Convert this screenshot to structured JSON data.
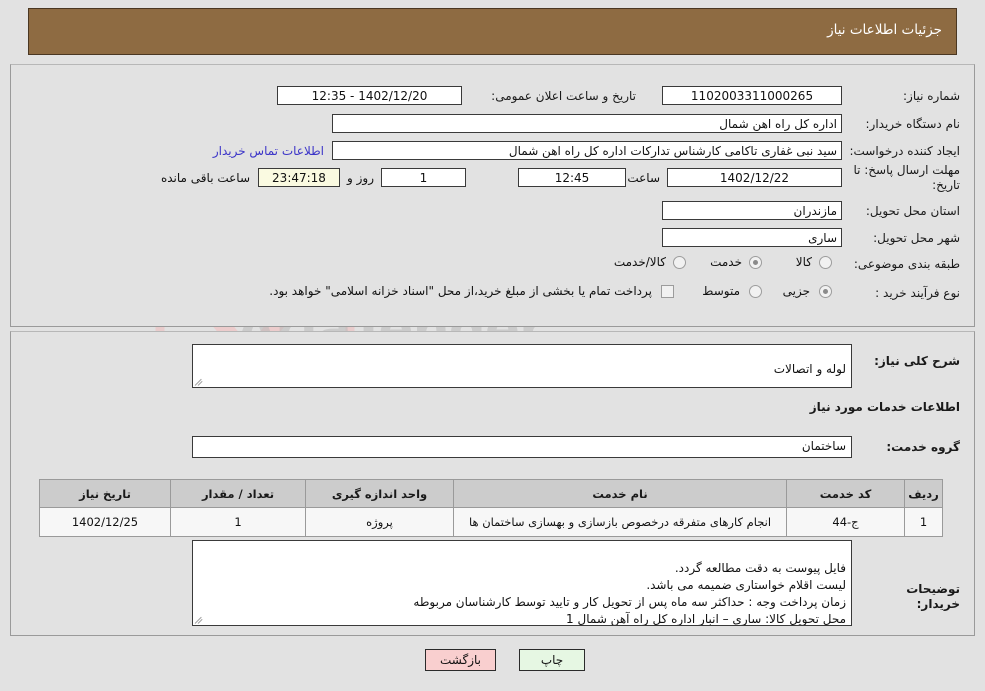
{
  "header": {
    "title": "جزئیات اطلاعات نیاز"
  },
  "top_form": {
    "need_number_label": "شماره نیاز:",
    "need_number_value": "1102003311000265",
    "announce_datetime_label": "تاریخ و ساعت اعلان عمومی:",
    "announce_datetime_value": "1402/12/20 - 12:35",
    "buyer_org_label": "نام دستگاه خریدار:",
    "buyer_org_value": "اداره کل راه اهن شمال",
    "requester_label": "ایجاد کننده درخواست:",
    "requester_value": "سید نبی غفاری تاکامی کارشناس تدارکات اداره کل راه اهن شمال",
    "contact_link": "اطلاعات تماس خریدار",
    "deadline_label": "مهلت ارسال پاسخ: تا تاریخ:",
    "deadline_date": "1402/12/22",
    "hour_label": "ساعت",
    "deadline_time": "12:45",
    "days_remaining": "1",
    "day_and_label": "روز و",
    "countdown": "23:47:18",
    "remaining_label": "ساعت باقی مانده",
    "province_label": "استان محل تحویل:",
    "province_value": "مازندران",
    "city_label": "شهر محل تحویل:",
    "city_value": "ساری",
    "category_label": "طبقه بندی موضوعی:",
    "category_options": [
      {
        "label": "کالا",
        "selected": false
      },
      {
        "label": "خدمت",
        "selected": true
      },
      {
        "label": "کالا/خدمت",
        "selected": false
      }
    ],
    "purchase_type_label": "نوع فرآیند خرید :",
    "purchase_type_options": [
      {
        "label": "جزیی",
        "selected": true
      },
      {
        "label": "متوسط",
        "selected": false
      }
    ],
    "treasury_checkbox_checked": false,
    "treasury_text": "پرداخت تمام یا بخشی از مبلغ خرید،از محل \"اسناد خزانه اسلامی\" خواهد بود."
  },
  "middle": {
    "general_desc_label": "شرح کلی نیاز:",
    "general_desc_value": "لوله و اتصالات",
    "services_heading": "اطلاعات خدمات مورد نیاز",
    "service_group_label": "گروه خدمت:",
    "service_group_value": "ساختمان",
    "table": {
      "headers": [
        "ردیف",
        "کد خدمت",
        "نام خدمت",
        "واحد اندازه گیری",
        "تعداد / مقدار",
        "تاریخ نیاز"
      ],
      "rows": [
        {
          "row": "1",
          "code": "ج-44",
          "name": "انجام کارهای متفرقه درخصوص بازسازی و بهسازی ساختمان ها",
          "unit": "پروژه",
          "qty": "1",
          "need_date": "1402/12/25"
        }
      ]
    },
    "buyer_notes_label": "توضیحات خریدار:",
    "buyer_notes_value": "فایل پیوست به دقت مطالعه گردد.\nلیست اقلام خواستاری ضمیمه می باشد.\nزمان پرداخت وجه : حداکثر سه ماه پس از تحویل کار و تایید توسط کارشناسان مربوطه\nمحل تحویل کالا: ساری – انبار اداره کل راه آهن شمال 1"
  },
  "footer": {
    "print_label": "چاپ",
    "back_label": "بازگشت"
  },
  "watermark": {
    "text": "AriaTender",
    "suffix": ".net"
  },
  "colors": {
    "header_bg": "#8e6b42",
    "page_bg": "#e2e2e2",
    "link": "#3b34c8",
    "print_btn": "#e6f7e3",
    "back_btn": "#f9cfcf",
    "countdown_bg": "#fafae1",
    "table_header_bg": "#cccccc"
  }
}
